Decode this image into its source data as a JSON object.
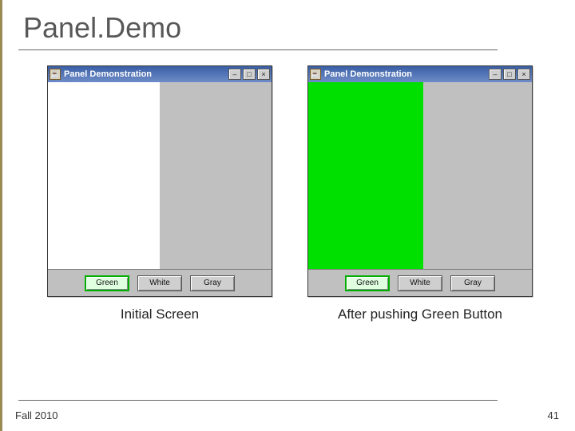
{
  "slide": {
    "title": "Panel.Demo",
    "footer_date": "Fall 2010",
    "footer_page": "41"
  },
  "window": {
    "title": "Panel Demonstration",
    "icon_glyph": "☕",
    "ctrl_min": "–",
    "ctrl_max": "□",
    "ctrl_close": "×"
  },
  "buttons": {
    "green": "Green",
    "white": "White",
    "gray": "Gray"
  },
  "captions": {
    "left": "Initial Screen",
    "right": "After pushing Green Button"
  }
}
